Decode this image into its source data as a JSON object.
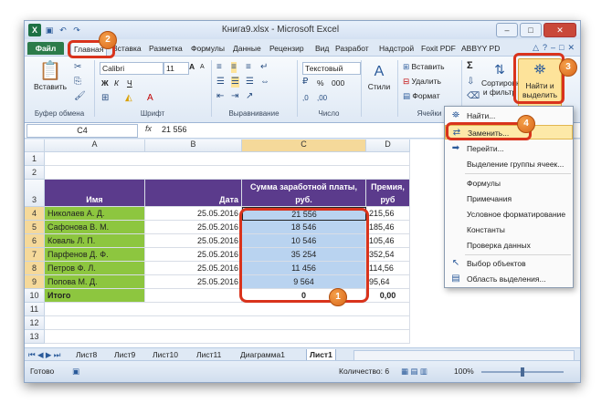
{
  "app": {
    "title": "Книга9.xlsx - Microsoft Excel",
    "logo": "X",
    "win_min": "–",
    "win_max": "□",
    "win_close": "✕"
  },
  "tabs": [
    "Файл",
    "Главная",
    "Вставка",
    "Разметка",
    "Формулы",
    "Данные",
    "Рецензир",
    "Вид",
    "Разработ",
    "Надстрой",
    "Foxit PDF",
    "ABBYY PD"
  ],
  "ribbon": {
    "paste": "Вставить",
    "font_name": "Calibri",
    "font_size": "11",
    "bold": "Ж",
    "italic": "К",
    "underline": "Ч",
    "grow_font": "A",
    "shrink_font": "A",
    "number_format": "Текстовый",
    "pct": "%",
    "thousands": "000",
    "styles": "Стили",
    "insert": "Вставить",
    "delete": "Удалить",
    "format": "Формат",
    "sigma": "Σ",
    "sort": "Сортировка",
    "sort2": "и фильтр",
    "find": "Найти и",
    "find2": "выделить",
    "groups": {
      "clipboard": "Буфер обмена",
      "font": "Шрифт",
      "align": "Выравнивание",
      "number": "Число",
      "cells": "Ячейки"
    }
  },
  "formula_bar": {
    "namebox": "C4",
    "fx": "fx",
    "value": "21 556"
  },
  "columns": [
    "A",
    "B",
    "C",
    "D"
  ],
  "rows": [
    "1",
    "2",
    "3",
    "4",
    "5",
    "6",
    "7",
    "8",
    "9",
    "10",
    "11",
    "12",
    "13"
  ],
  "table": {
    "headers": [
      "Имя",
      "Дата",
      "Сумма заработной платы,",
      "руб.",
      "Премия,",
      "руб"
    ],
    "data": [
      [
        "Николаев А. Д.",
        "25.05.2016",
        "21 556",
        "215,56"
      ],
      [
        "Сафонова В. М.",
        "25.05.2016",
        "18 546",
        "185,46"
      ],
      [
        "Коваль Л. П.",
        "25.05.2016",
        "10 546",
        "105,46"
      ],
      [
        "Парфенов Д. Ф.",
        "25.05.2016",
        "35 254",
        "352,54"
      ],
      [
        "Петров Ф. Л.",
        "25.05.2016",
        "11 456",
        "114,56"
      ],
      [
        "Попова М. Д.",
        "25.05.2016",
        "9 564",
        "95,64"
      ]
    ],
    "total": [
      "Итого",
      "",
      "0",
      "0,00"
    ]
  },
  "menu": {
    "items": [
      {
        "label": "Найти...",
        "icon": "binoculars-icon"
      },
      {
        "label": "Заменить...",
        "icon": "replace-icon"
      },
      {
        "label": "Перейти...",
        "icon": "arrow-right-icon"
      },
      {
        "label": "Выделение группы ячеек...",
        "icon": ""
      },
      {
        "label": "Формулы",
        "icon": ""
      },
      {
        "label": "Примечания",
        "icon": ""
      },
      {
        "label": "Условное форматирование",
        "icon": ""
      },
      {
        "label": "Константы",
        "icon": ""
      },
      {
        "label": "Проверка данных",
        "icon": ""
      },
      {
        "label": "Выбор объектов",
        "icon": "cursor-icon"
      },
      {
        "label": "Область выделения...",
        "icon": "selection-pane-icon"
      }
    ]
  },
  "sheet_tabs": [
    "Лист8",
    "Лист9",
    "Лист10",
    "Лист11",
    "Диаграмма1",
    "Лист1"
  ],
  "status": {
    "ready": "Готово",
    "count": "Количество: 6",
    "zoom": "100%"
  },
  "callouts": [
    "1",
    "2",
    "3",
    "4"
  ],
  "colors": {
    "header_purple": "#5b3b8c",
    "name_green": "#8dc63f",
    "callout_orange": "#e8782a",
    "highlight_red": "#d9331c",
    "selection_blue": "#b9d3f0"
  }
}
